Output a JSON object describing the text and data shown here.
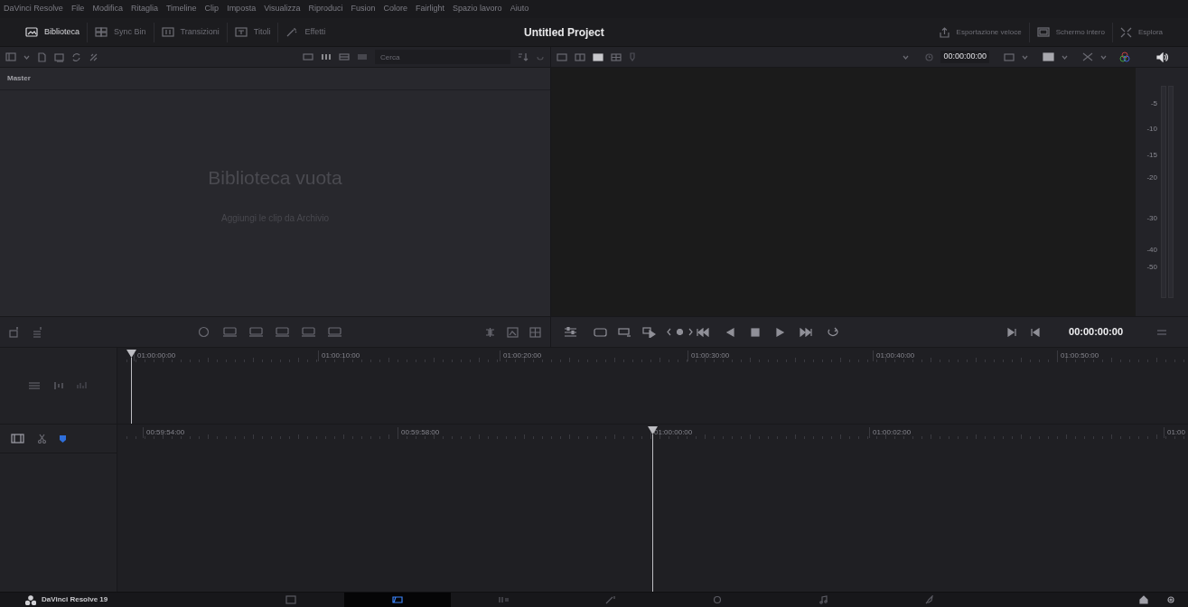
{
  "menu_bar": [
    "DaVinci Resolve",
    "File",
    "Modifica",
    "Ritaglia",
    "Timeline",
    "Clip",
    "Imposta",
    "Visualizza",
    "Riproduci",
    "Fusion",
    "Colore",
    "Fairlight",
    "Spazio lavoro",
    "Aiuto"
  ],
  "toolbar": {
    "left": [
      {
        "label": "Biblioteca",
        "kind": "image",
        "selected": true
      },
      {
        "label": "Sync Bin",
        "kind": "sync",
        "selected": false
      },
      {
        "label": "Transizioni",
        "kind": "transition",
        "selected": false
      },
      {
        "label": "Titoli",
        "kind": "title",
        "selected": false
      },
      {
        "label": "Effetti",
        "kind": "effects",
        "selected": false
      }
    ],
    "project_title": "Untitled Project",
    "right": [
      {
        "label": "Esportazione veloce",
        "kind": "export"
      },
      {
        "label": "Schermo intero",
        "kind": "fullscreen"
      },
      {
        "label": "Esplora",
        "kind": "explore"
      }
    ]
  },
  "media_pool": {
    "search": {
      "placeholder": "Cerca"
    },
    "folder": "Master",
    "empty_title": "Biblioteca vuota",
    "empty_hint": "Aggiungi le clip da Archivio"
  },
  "viewer": {
    "timecode": "00:00:00:00"
  },
  "audio_meter": {
    "scale": [
      "-5",
      "-10",
      "-15",
      "-20",
      "-30",
      "-40",
      "-50"
    ]
  },
  "transport": {
    "timecode": "00:00:00:00"
  },
  "upper_timeline": {
    "ruler": [
      "01:00:00:00",
      "01:00:10:00",
      "01:00:20:00",
      "01:00:30:00",
      "01:00:40:00",
      "01:00:50:00"
    ]
  },
  "lower_timeline": {
    "ruler": [
      "00:59:54:00",
      "00:59:58:00",
      "01:00:00:00",
      "01:00:02:00",
      "01:00"
    ]
  },
  "page_bar": {
    "app_name": "DaVinci Resolve 19",
    "pages": [
      {
        "kind": "media",
        "selected": false
      },
      {
        "kind": "cut",
        "selected": true
      },
      {
        "kind": "edit",
        "selected": false
      },
      {
        "kind": "fusion",
        "selected": false
      },
      {
        "kind": "color",
        "selected": false
      },
      {
        "kind": "fairlight",
        "selected": false
      },
      {
        "kind": "deliver",
        "selected": false
      }
    ]
  }
}
